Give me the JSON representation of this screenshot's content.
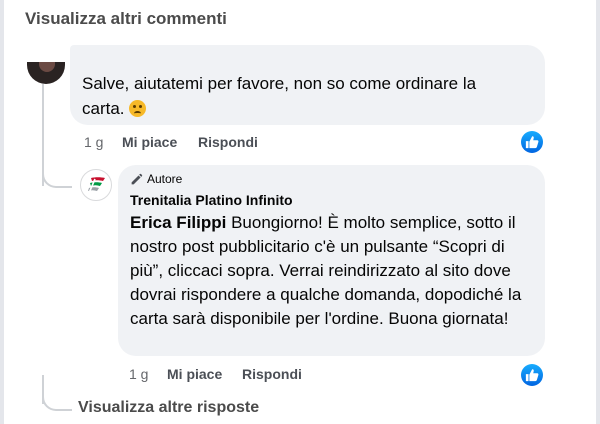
{
  "header": {
    "more_comments": "Visualizza altri commenti"
  },
  "comment": {
    "text": "Salve, aiutatemi per favore, non so come ordinare la carta.",
    "emoji": "sad-face-emoji",
    "time": "1 g",
    "like_label": "Mi piace",
    "reply_label": "Rispondi"
  },
  "reply": {
    "author_badge": "Autore",
    "page_name": "Trenitalia Platino Infinito",
    "tagged_name": "Erica Filippi",
    "text": "Buongiorno! È molto semplice, sotto il nostro post pubblicitario c'è un pulsante “Scopri di più”, cliccaci sopra. Verrai reindirizzato al sito dove dovrai rispondere a qualche domanda, dopodiché la carta sarà disponibile per l'ordine. Buona giornata!",
    "time": "1 g",
    "like_label": "Mi piace",
    "reply_label": "Rispondi"
  },
  "footer": {
    "more_replies": "Visualizza altre risposte"
  },
  "colors": {
    "bubble_bg": "#f0f2f5",
    "like_blue": "#0866ff",
    "brand_red": "#c8102e",
    "brand_green": "#009a44"
  },
  "icons": {
    "like": "thumbs-up-icon",
    "author": "pencil-icon",
    "brand": "trenitalia-logo-icon"
  }
}
